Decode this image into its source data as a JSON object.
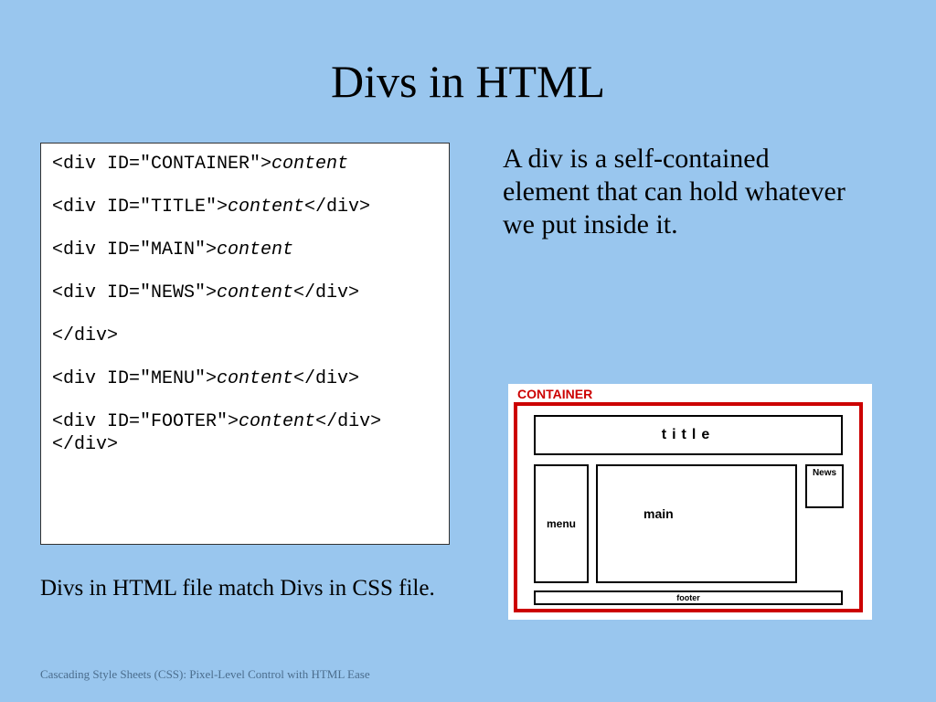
{
  "title": "Divs in HTML",
  "code": {
    "l1_tag": "<div ID=\"CONTAINER\">",
    "l1_it": "content",
    "l2_tag": "<div ID=\"TITLE\">",
    "l2_it": "content",
    "l2_end": "</div>",
    "l3_tag": "<div ID=\"MAIN\">",
    "l3_it": "content",
    "l4_tag": "<div ID=\"NEWS\">",
    "l4_it": "content",
    "l4_end": "</div>",
    "l5": "</div>",
    "l6_tag": "<div ID=\"MENU\">",
    "l6_it": "content",
    "l6_end": "</div>",
    "l7_tag": "<div ID=\"FOOTER\">",
    "l7_it": "content",
    "l7_end": "</div></div>"
  },
  "desc": "A div is a self-contained element that can hold whatever we put inside it.",
  "sub_note": "Divs in HTML file match Divs in CSS file.",
  "footer_text": "Cascading Style Sheets (CSS): Pixel-Level Control with HTML Ease",
  "diagram": {
    "container_label": "CONTAINER",
    "title": "title",
    "menu": "menu",
    "main": "main",
    "news": "News",
    "footer": "footer"
  }
}
